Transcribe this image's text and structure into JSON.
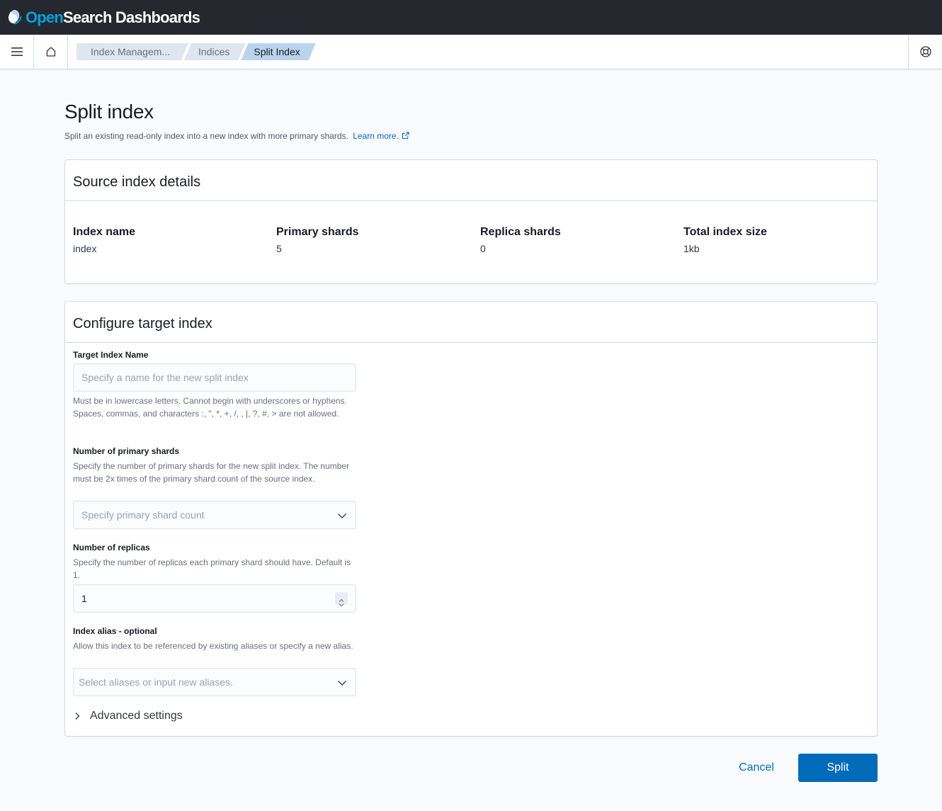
{
  "header": {
    "brand_open": "Open",
    "brand_rest": "Search Dashboards"
  },
  "nav": {
    "menu_icon": "hamburger-menu-icon",
    "home_icon": "home-icon",
    "help_icon": "help-lifebuoy-icon",
    "breadcrumbs": [
      "Index Managem...",
      "Indices",
      "Split Index"
    ]
  },
  "page": {
    "title": "Split index",
    "description": "Split an existing read-only index into a new index with more primary shards.",
    "learn_more": "Learn more."
  },
  "source": {
    "title": "Source index details",
    "fields": [
      {
        "label": "Index name",
        "value": "index"
      },
      {
        "label": "Primary shards",
        "value": "5"
      },
      {
        "label": "Replica shards",
        "value": "0"
      },
      {
        "label": "Total index size",
        "value": "1kb"
      }
    ]
  },
  "config": {
    "title": "Configure target index",
    "target_name": {
      "label": "Target Index Name",
      "placeholder": "Specify a name for the new split index",
      "help": "Must be in lowercase letters. Cannot begin with underscores or hyphens. Spaces, commas, and characters :, \", *, +, /, , |, ?, #, > are not allowed."
    },
    "primary_shards": {
      "label": "Number of primary shards",
      "help": "Specify the number of primary shards for the new split index. The number must be 2x times of the primary shard count of the source index.",
      "placeholder": "Specify primary shard count"
    },
    "replicas": {
      "label": "Number of replicas",
      "help": "Specify the number of replicas each primary shard should have. Default is 1.",
      "value": "1"
    },
    "alias": {
      "label": "Index alias - optional",
      "help": "Allow this index to be referenced by existing aliases or specify a new alias.",
      "placeholder": "Select aliases or input new aliases."
    },
    "advanced": "Advanced settings"
  },
  "footer": {
    "cancel": "Cancel",
    "split": "Split"
  },
  "colors": {
    "header_bg": "#25282f",
    "accent": "#006bb8",
    "brand_blue": "#00a3e0"
  }
}
